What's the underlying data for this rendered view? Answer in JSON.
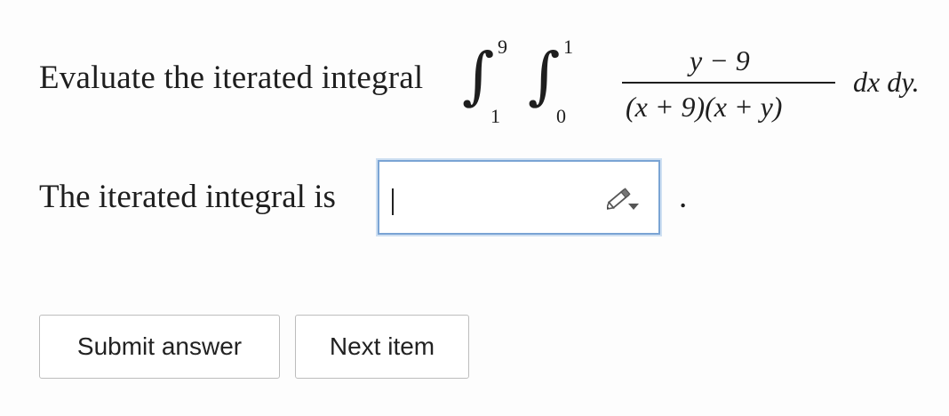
{
  "question": {
    "prompt": "Evaluate the iterated integral",
    "integral": {
      "outer_lower": "1",
      "outer_upper": "9",
      "inner_lower": "0",
      "inner_upper": "1",
      "numerator": "y − 9",
      "denominator": "(x + 9)(x + y)",
      "differentials": "dx dy."
    }
  },
  "answer": {
    "label": "The iterated integral is",
    "value": "",
    "trailing": ".",
    "edit_icon": "pencil-icon"
  },
  "buttons": {
    "submit_label": "Submit answer",
    "next_label": "Next item"
  }
}
